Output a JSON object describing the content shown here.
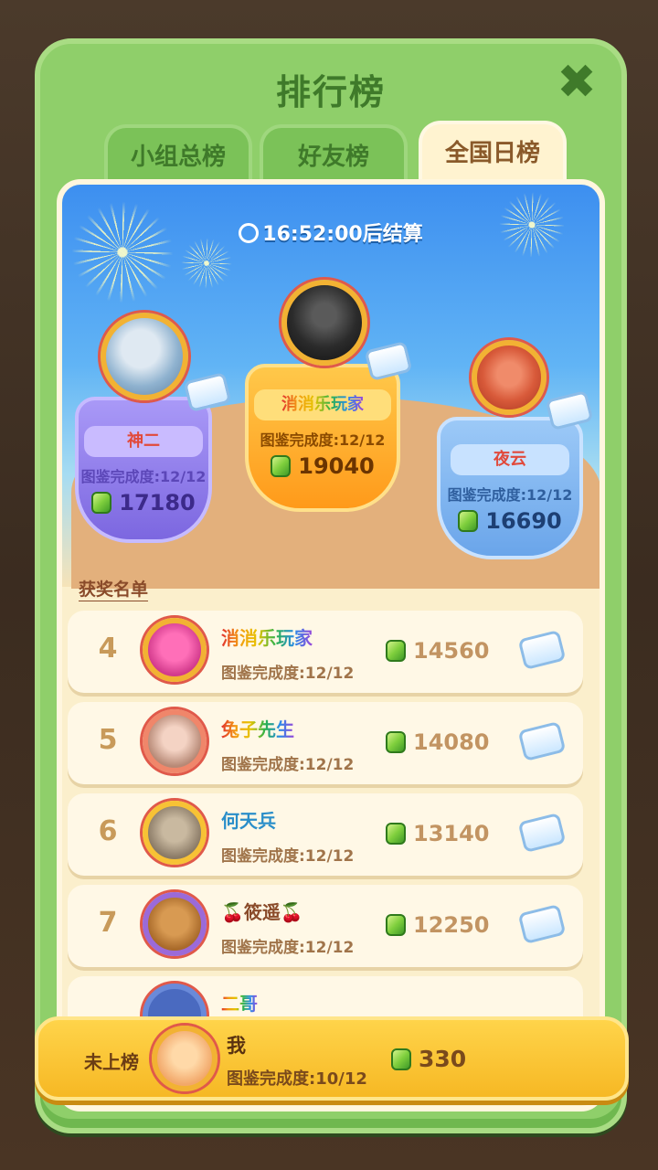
{
  "title": "排行榜",
  "tabs": [
    "小组总榜",
    "好友榜",
    "全国日榜"
  ],
  "active_tab": "全国日榜",
  "timer": "16:52:00后结算",
  "podium": [
    {
      "rank": 2,
      "name": "神二",
      "progress": "图鉴完成度:12/12",
      "score": "17180"
    },
    {
      "rank": 1,
      "name": "消消乐玩家",
      "progress": "图鉴完成度:12/12",
      "score": "19040"
    },
    {
      "rank": 3,
      "name": "夜云",
      "progress": "图鉴完成度:12/12",
      "score": "16690"
    }
  ],
  "winners_label": "获奖名单",
  "rows": [
    {
      "rank": "4",
      "name": "消消乐玩家",
      "progress": "图鉴完成度:12/12",
      "score": "14560"
    },
    {
      "rank": "5",
      "name": "兔子先生",
      "progress": "图鉴完成度:12/12",
      "score": "14080"
    },
    {
      "rank": "6",
      "name": "何天兵",
      "progress": "图鉴完成度:12/12",
      "score": "13140"
    },
    {
      "rank": "7",
      "name": "🍒筱遥🍒",
      "progress": "图鉴完成度:12/12",
      "score": "12250"
    },
    {
      "rank": "",
      "name": "二哥",
      "progress": "",
      "score": ""
    }
  ],
  "me": {
    "status": "未上榜",
    "name": "我",
    "progress": "图鉴完成度:10/12",
    "score": "330"
  },
  "colors": {
    "panel_green": "#8fcf6a",
    "title_green": "#3f7a2a",
    "card_cream": "#fbefcc",
    "purple_podium": "#9e8af0",
    "orange_podium": "#ffb22e",
    "blue_podium": "#7fb7f2",
    "bar_yellow": "#ffd44a"
  },
  "icons": [
    "close-icon",
    "clock-icon",
    "gem-icon",
    "reward-box-icon",
    "firework-icon"
  ]
}
